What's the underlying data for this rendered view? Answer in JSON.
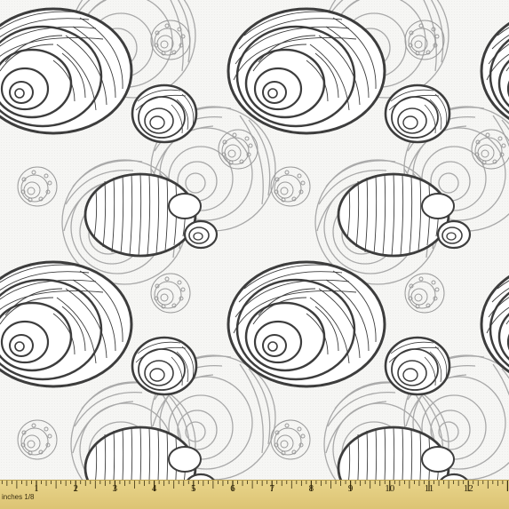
{
  "image": {
    "subject": "fabric-swatch",
    "colors": {
      "background": "#f6f6f4",
      "ink_dark": "#3d3d3d",
      "ink_light": "#a9a9a9",
      "ruler": "#e2cb7d"
    }
  },
  "ruler": {
    "unit_label": "inches 1/8",
    "numbers": [
      "1",
      "2",
      "3",
      "4",
      "5",
      "6",
      "7",
      "8",
      "9",
      "10",
      "11",
      "12"
    ]
  }
}
